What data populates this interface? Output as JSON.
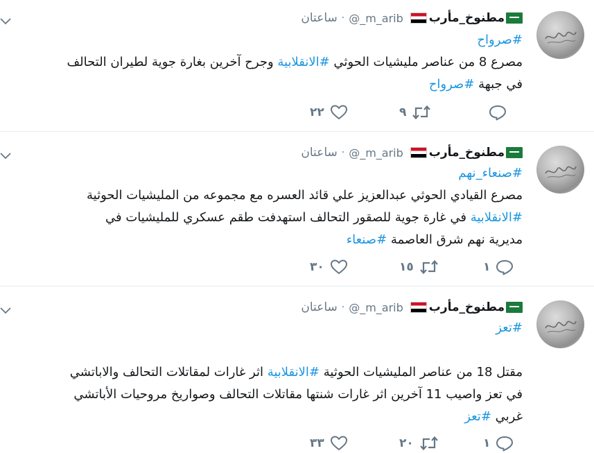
{
  "tweets": [
    {
      "name": "مطنوخ_مأرب",
      "handle": "@_m_arib",
      "time": "ساعتان",
      "lines": [
        [
          {
            "t": "#صرواح",
            "tag": true
          }
        ],
        [
          {
            "t": "مصرع 8 من عناصر مليشيات الحوثي "
          },
          {
            "t": "#الانقلابية",
            "tag": true
          },
          {
            "t": " وجرح آخرين بغارة جوية لطيران التحالف"
          }
        ],
        [
          {
            "t": "في جبهة "
          },
          {
            "t": "#صرواح",
            "tag": true
          }
        ]
      ],
      "reply_count": "",
      "retweet_count": "٩",
      "like_count": "٢٢"
    },
    {
      "name": "مطنوخ_مأرب",
      "handle": "@_m_arib",
      "time": "ساعتان",
      "lines": [
        [
          {
            "t": "#صنعاء_نهم",
            "tag": true
          }
        ],
        [
          {
            "t": "مصرع القيادي الحوثي عبدالعزيز علي قائد العسره مع مجموعه من المليشيات الحوثية"
          }
        ],
        [
          {
            "t": "#الانقلابية",
            "tag": true
          },
          {
            "t": " في غارة جوية للصقور التحالف استهدفت طقم عسكري للمليشيات في"
          }
        ],
        [
          {
            "t": "مديرية نهم شرق العاصمة "
          },
          {
            "t": "#صنعاء",
            "tag": true
          }
        ]
      ],
      "reply_count": "١",
      "retweet_count": "١٥",
      "like_count": "٣٠"
    },
    {
      "name": "مطنوخ_مأرب",
      "handle": "@_m_arib",
      "time": "ساعتان",
      "lines": [
        [
          {
            "t": "#تعز",
            "tag": true
          }
        ],
        [
          {
            "t": ""
          }
        ],
        [
          {
            "t": "مقتل 18 من عناصر المليشيات الحوثية "
          },
          {
            "t": "#الانقلابية",
            "tag": true
          },
          {
            "t": " اثر غارات لمقاتلات التحالف والاباتشي"
          }
        ],
        [
          {
            "t": "في تعز واصيب 11 آخرين اثر غارات شنتها مقاتلات التحالف وصواريخ مروحيات الأباتشي"
          }
        ],
        [
          {
            "t": "غربي "
          },
          {
            "t": "#تعز",
            "tag": true
          }
        ]
      ],
      "reply_count": "١",
      "retweet_count": "٢٠",
      "like_count": "٣٣"
    }
  ],
  "icons": {
    "chevron": "chevron-down-icon",
    "reply": "reply-icon",
    "retweet": "retweet-icon",
    "like": "like-icon",
    "flag_sa": "saudi-flag-icon",
    "flag_ye": "yemen-flag-icon"
  },
  "colors": {
    "hashtag": "#1b95e0",
    "muted": "#657786",
    "text": "#14171a",
    "separator": "#e6ecf0"
  }
}
